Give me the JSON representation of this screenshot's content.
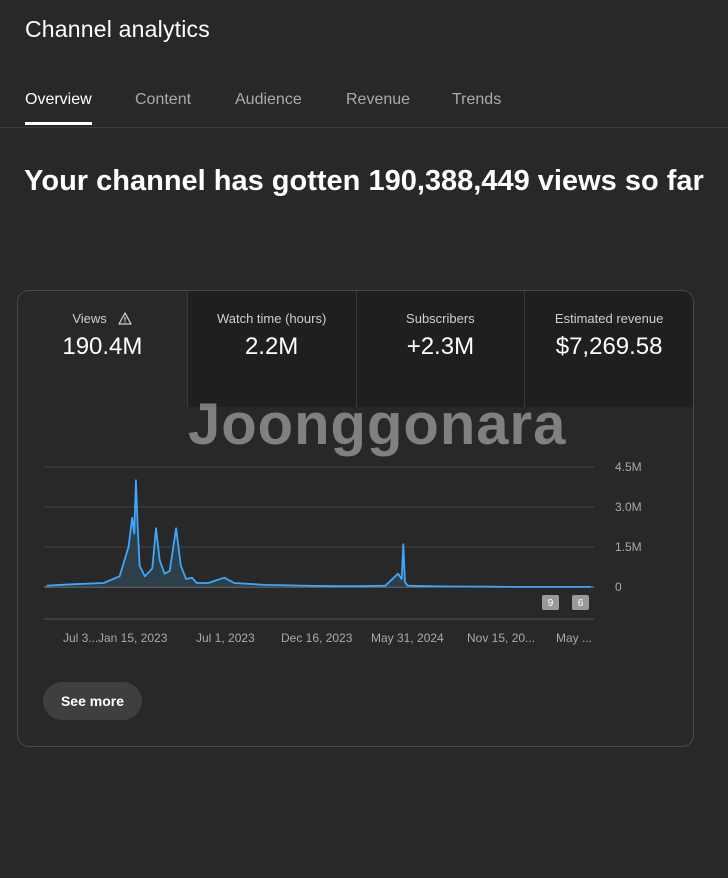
{
  "header": {
    "title": "Channel analytics"
  },
  "tabs": [
    {
      "label": "Overview",
      "active": true
    },
    {
      "label": "Content"
    },
    {
      "label": "Audience"
    },
    {
      "label": "Revenue"
    },
    {
      "label": "Trends"
    }
  ],
  "headline": "Your channel has gotten 190,388,449 views so far",
  "metrics": [
    {
      "label": "Views",
      "value": "190.4M",
      "icon": "warning-icon"
    },
    {
      "label": "Watch time (hours)",
      "value": "2.2M"
    },
    {
      "label": "Subscribers",
      "value": "+2.3M"
    },
    {
      "label": "Estimated revenue",
      "value": "$7,269.58"
    }
  ],
  "watermark": "Joonggonara",
  "chart_data": {
    "type": "area",
    "series": [
      {
        "x": [
          "2022-07-30",
          "2022-09-15",
          "2022-11-15",
          "2022-12-15",
          "2023-01-01",
          "2023-01-08",
          "2023-01-12",
          "2023-01-15",
          "2023-01-18",
          "2023-01-22",
          "2023-02-01",
          "2023-02-15",
          "2023-02-22",
          "2023-03-01",
          "2023-03-10",
          "2023-03-20",
          "2023-04-01",
          "2023-04-10",
          "2023-04-20",
          "2023-05-01",
          "2023-05-10",
          "2023-06-01",
          "2023-07-01",
          "2023-07-20",
          "2023-08-15",
          "2023-09-15",
          "2023-11-01",
          "2023-12-16",
          "2024-02-01",
          "2024-03-15",
          "2024-05-01",
          "2024-05-25",
          "2024-06-01",
          "2024-06-04",
          "2024-06-07",
          "2024-06-12",
          "2024-07-15",
          "2024-09-01",
          "2024-11-15",
          "2025-01-01",
          "2025-03-01",
          "2025-05-01",
          "2025-05-25"
        ],
        "values": [
          50000,
          100000,
          150000,
          400000,
          1500000,
          2600000,
          2000000,
          4000000,
          2400000,
          800000,
          400000,
          700000,
          2200000,
          1000000,
          500000,
          600000,
          2200000,
          800000,
          300000,
          350000,
          150000,
          150000,
          350000,
          150000,
          120000,
          80000,
          60000,
          40000,
          30000,
          30000,
          50000,
          500000,
          300000,
          1600000,
          200000,
          50000,
          30000,
          20000,
          10000,
          5000,
          5000,
          5000,
          5000
        ]
      }
    ],
    "x_tick_labels": [
      "Jul 3...",
      "Jan 15, 2023",
      "Jul 1, 2023",
      "Dec 16, 2023",
      "May 31, 2024",
      "Nov 15, 20...",
      "May ..."
    ],
    "y_tick_labels": [
      "4.5M",
      "3.0M",
      "1.5M",
      "0"
    ],
    "ylim": [
      0,
      4500000
    ],
    "grid": true,
    "markers": [
      "9",
      "6"
    ],
    "colors": {
      "line": "#3ea6ff",
      "fill": "#2e4550"
    }
  },
  "see_more_label": "See more"
}
